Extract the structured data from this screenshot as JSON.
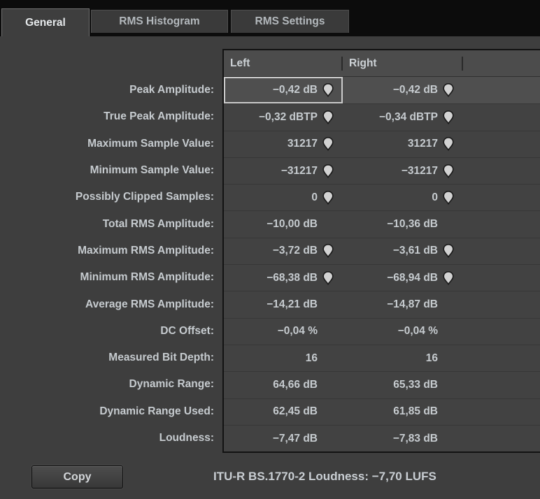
{
  "tabs": [
    {
      "label": "General",
      "active": true
    },
    {
      "label": "RMS Histogram",
      "active": false
    },
    {
      "label": "RMS Settings",
      "active": false
    }
  ],
  "table": {
    "columns": {
      "left": "Left",
      "right": "Right"
    },
    "rows": [
      {
        "label": "Peak Amplitude:",
        "left": "−0,42 dB",
        "right": "−0,42 dB",
        "pin": true,
        "selected": true
      },
      {
        "label": "True Peak Amplitude:",
        "left": "−0,32 dBTP",
        "right": "−0,34 dBTP",
        "pin": true
      },
      {
        "label": "Maximum Sample Value:",
        "left": "31217",
        "right": "31217",
        "pin": true
      },
      {
        "label": "Minimum Sample Value:",
        "left": "−31217",
        "right": "−31217",
        "pin": true
      },
      {
        "label": "Possibly Clipped Samples:",
        "left": "0",
        "right": "0",
        "pin": true
      },
      {
        "label": "Total RMS Amplitude:",
        "left": "−10,00 dB",
        "right": "−10,36 dB",
        "pin": false
      },
      {
        "label": "Maximum RMS Amplitude:",
        "left": "−3,72 dB",
        "right": "−3,61 dB",
        "pin": true
      },
      {
        "label": "Minimum RMS Amplitude:",
        "left": "−68,38 dB",
        "right": "−68,94 dB",
        "pin": true
      },
      {
        "label": "Average RMS Amplitude:",
        "left": "−14,21 dB",
        "right": "−14,87 dB",
        "pin": false
      },
      {
        "label": "DC Offset:",
        "left": "−0,04 %",
        "right": "−0,04 %",
        "pin": false
      },
      {
        "label": "Measured Bit Depth:",
        "left": "16",
        "right": "16",
        "pin": false
      },
      {
        "label": "Dynamic Range:",
        "left": "64,66 dB",
        "right": "65,33 dB",
        "pin": false
      },
      {
        "label": "Dynamic Range Used:",
        "left": "62,45 dB",
        "right": "61,85 dB",
        "pin": false
      },
      {
        "label": "Loudness:",
        "left": "−7,47 dB",
        "right": "−7,83 dB",
        "pin": false
      }
    ]
  },
  "footer": {
    "copy_label": "Copy",
    "loudness_summary": "ITU-R BS.1770-2 Loudness: −7,70 LUFS"
  },
  "colors": {
    "background": "#3e3e3e",
    "tabbar": "#0c0c0c",
    "row": "#424242",
    "header_row": "#4c4c4c",
    "selected_row": "#4f4f4f",
    "text": "#c6cbcf",
    "selection_border": "#cbcbcb"
  }
}
